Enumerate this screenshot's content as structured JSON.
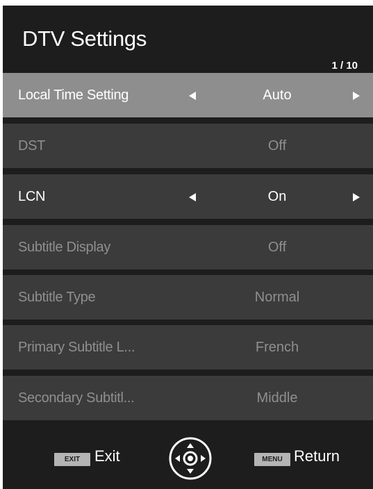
{
  "header": {
    "title": "DTV Settings",
    "page_indicator": "1 / 10"
  },
  "menu": {
    "items": [
      {
        "label": "Local Time Setting",
        "value": "Auto"
      },
      {
        "label": "DST",
        "value": "Off"
      },
      {
        "label": "LCN",
        "value": "On"
      },
      {
        "label": "Subtitle Display",
        "value": "Off"
      },
      {
        "label": "Subtitle Type",
        "value": "Normal"
      },
      {
        "label": "Primary Subtitle L...",
        "value": "French"
      },
      {
        "label": "Secondary Subtitl...",
        "value": "Middle"
      }
    ]
  },
  "footer": {
    "exit_key": "EXIT",
    "exit_label": "Exit",
    "menu_key": "MENU",
    "return_label": "Return",
    "nav_icon": "dpad-icon"
  },
  "colors": {
    "background": "#1d1d1d",
    "row": "#3b3b3b",
    "row_selected": "#8e8e8e",
    "text_active": "#ffffff",
    "text_disabled": "#8f8f8f",
    "key_badge": "#b4b4b4"
  }
}
